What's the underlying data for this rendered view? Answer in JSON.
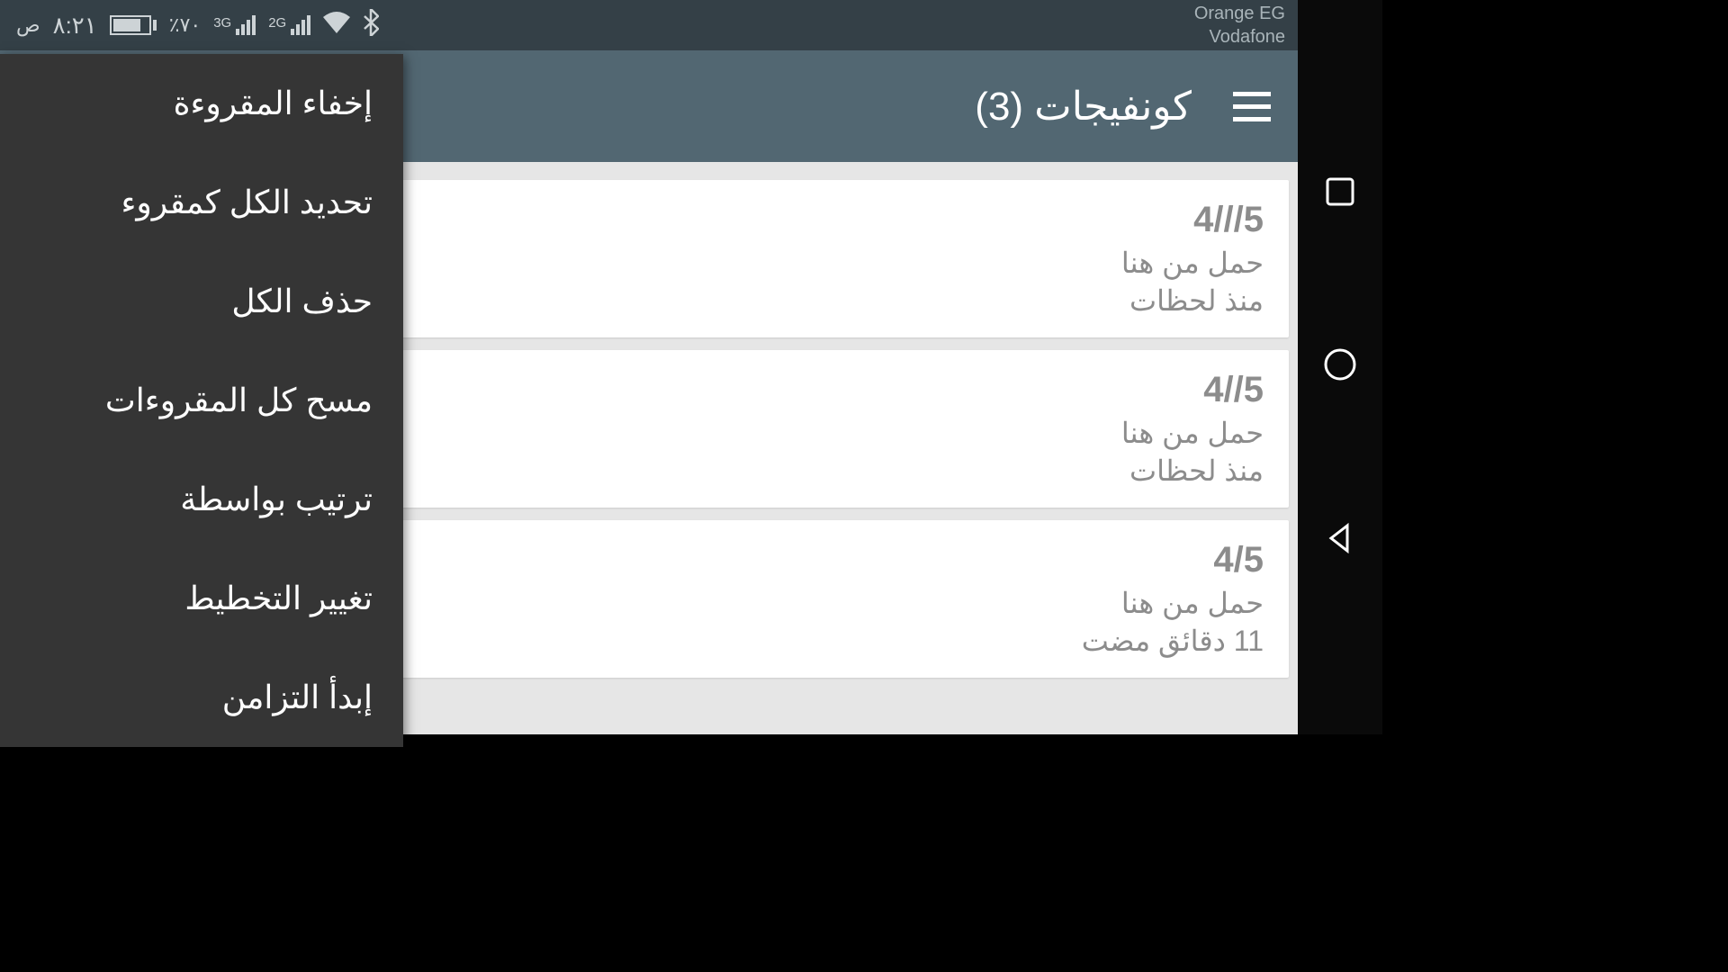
{
  "statusbar": {
    "time": "٨:٢١",
    "ampm": "ص",
    "battery_pct": "٪٧٠",
    "gen1": "3G",
    "gen2": "2G",
    "carrier1": "Orange EG",
    "carrier2": "Vodafone"
  },
  "appbar": {
    "title": "كونفيجات (3)"
  },
  "cards": [
    {
      "title": "4///5",
      "subtitle": "حمل من هنا",
      "time": "منذ لحظات"
    },
    {
      "title": "4//5",
      "subtitle": "حمل من هنا",
      "time": "منذ لحظات"
    },
    {
      "title": "4/5",
      "subtitle": "حمل من هنا",
      "time": "11 دقائق مضت"
    }
  ],
  "menu": [
    "إخفاء المقروءة",
    "تحديد الكل كمقروء",
    "حذف الكل",
    "مسح كل المقروءات",
    "ترتيب بواسطة",
    "تغيير التخطيط",
    "إبدأ التزامن"
  ]
}
